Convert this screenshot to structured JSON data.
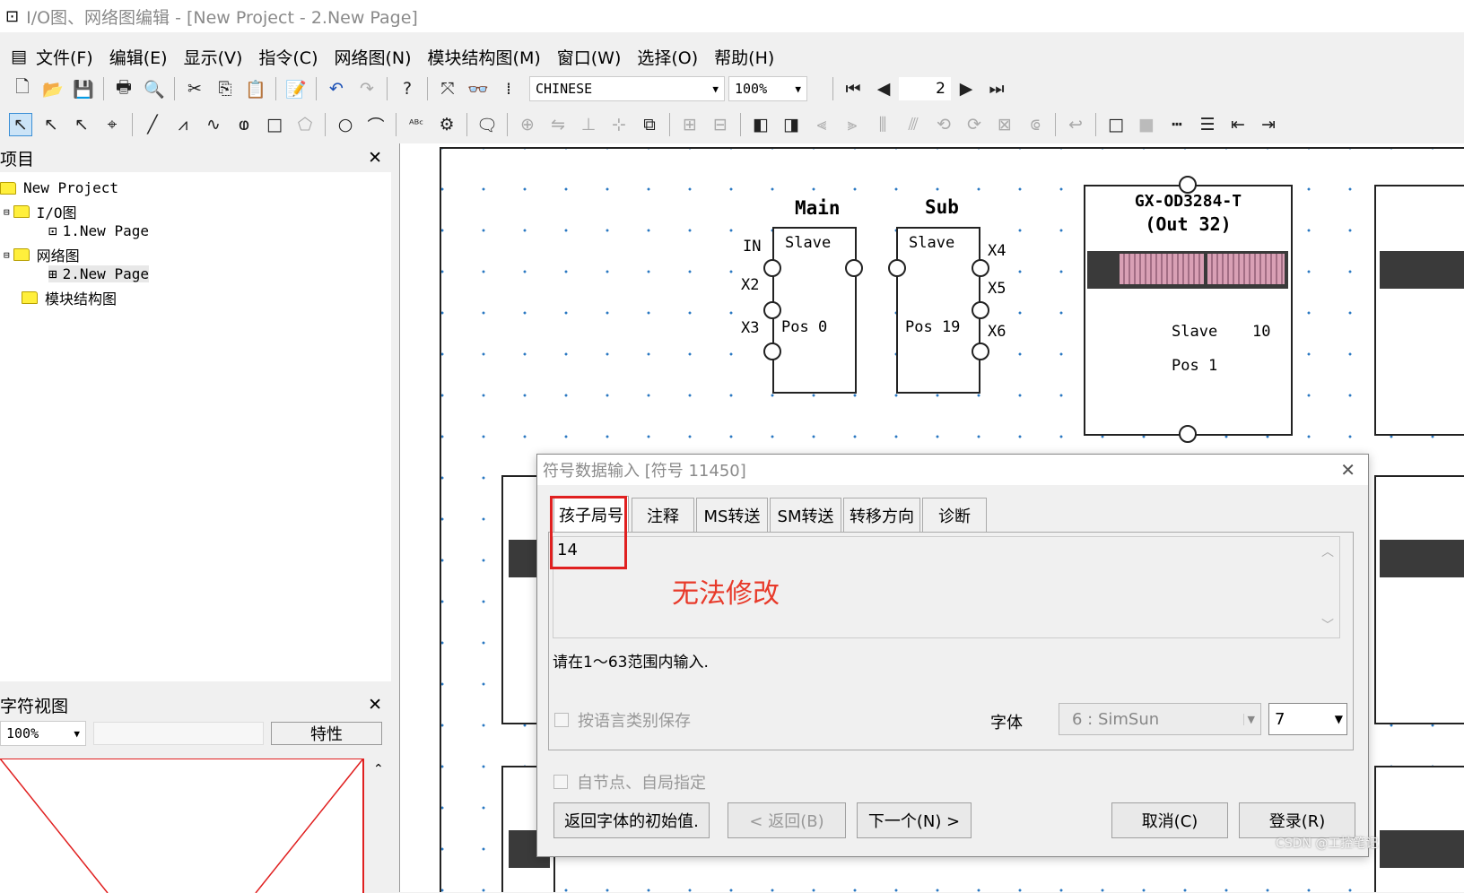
{
  "window": {
    "title": "I/O图、网络图编辑 - [New Project - 2.New Page]"
  },
  "menu": [
    "文件(F)",
    "编辑(E)",
    "显示(V)",
    "指令(C)",
    "网络图(N)",
    "模块结构图(M)",
    "窗口(W)",
    "选择(O)",
    "帮助(H)"
  ],
  "toolbar": {
    "font_combo": "CHINESE",
    "zoom_combo": "100%",
    "page_number": "2"
  },
  "project_panel": {
    "title": "项目",
    "tree": {
      "root": "New Project",
      "io": "I/O图",
      "io_page": "1.New Page",
      "network": "网络图",
      "network_page": "2.New Page",
      "module": "模块结构图"
    }
  },
  "char_view": {
    "title": "字符视图",
    "zoom": "100%",
    "property_button": "特性"
  },
  "diagram": {
    "main": {
      "title": "Main",
      "role": "Slave",
      "in": "IN",
      "x2": "X2",
      "x3": "X3",
      "pos": "Pos 0"
    },
    "sub": {
      "title": "Sub",
      "role": "Slave",
      "x4": "X4",
      "x5": "X5",
      "x6": "X6",
      "pos": "Pos 19"
    },
    "module": {
      "name": "GX-OD3284-T",
      "desc": "(Out 32)",
      "role": "Slave",
      "num": "10",
      "pos": "Pos 1"
    }
  },
  "dialog": {
    "title": "符号数据输入 [符号 11450]",
    "tabs": [
      "孩子局号",
      "注释",
      "MS转送",
      "SM转送",
      "转移方向",
      "诊断"
    ],
    "value": "14",
    "annotation": "无法修改",
    "hint": "请在1～63范围内输入.",
    "save_by_language": "按语言类别保存",
    "font_label": "字体",
    "font_value": "6 : SimSun",
    "font_size": "7",
    "self_node": "自节点、自局指定",
    "buttons": {
      "reset_font": "返回字体的初始值.",
      "back": "< 返回(B)",
      "next": "下一个(N) >",
      "cancel": "取消(C)",
      "login": "登录(R)"
    }
  },
  "watermark": "CSDN @工控笔记",
  "colors": {
    "highlight": "#e02020",
    "annotation": "#e83a2a",
    "dots": "#2a78c2"
  }
}
